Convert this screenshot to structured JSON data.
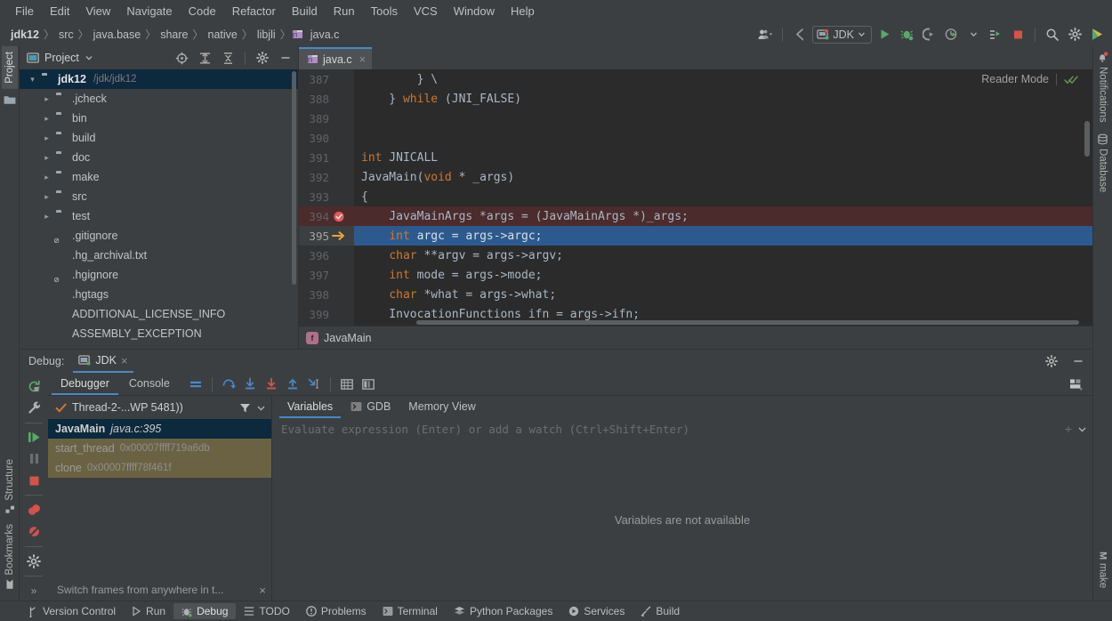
{
  "menubar": {
    "items": [
      "File",
      "Edit",
      "View",
      "Navigate",
      "Code",
      "Refactor",
      "Build",
      "Run",
      "Tools",
      "VCS",
      "Window",
      "Help"
    ]
  },
  "navbar": {
    "breadcrumbs": [
      "jdk12",
      "src",
      "java.base",
      "share",
      "native",
      "libjli",
      "java.c"
    ],
    "separator": "〉",
    "run_config": "JDK",
    "toolbar_icons": [
      "user-avatar-icon",
      "back-arrow-icon",
      "run-config-selector",
      "run-icon",
      "debug-icon",
      "run-with-coverage-icon",
      "profiler-icon",
      "attach-process-icon",
      "stop-icon",
      "search-everywhere-icon",
      "settings-gear-icon",
      "code-with-me-icon"
    ]
  },
  "left_strip": {
    "tabs": [
      "Project",
      "Structure",
      "Bookmarks"
    ],
    "active": "Project"
  },
  "right_strip": {
    "tabs": [
      "Notifications",
      "Database",
      "make"
    ]
  },
  "project_panel": {
    "title": "Project",
    "toolbar": [
      "select-opened-file-icon",
      "expand-all-icon",
      "collapse-all-icon",
      "settings-gear-icon",
      "hide-icon"
    ],
    "tree": [
      {
        "label": "jdk12",
        "path": "/jdk/jdk12",
        "type": "folder",
        "expanded": true,
        "selected": true,
        "indent": 0
      },
      {
        "label": ".jcheck",
        "type": "folder",
        "expanded": false,
        "indent": 1
      },
      {
        "label": "bin",
        "type": "folder",
        "expanded": false,
        "indent": 1
      },
      {
        "label": "build",
        "type": "folder",
        "expanded": false,
        "indent": 1
      },
      {
        "label": "doc",
        "type": "folder",
        "expanded": false,
        "indent": 1
      },
      {
        "label": "make",
        "type": "folder",
        "expanded": false,
        "indent": 1
      },
      {
        "label": "src",
        "type": "folder",
        "expanded": false,
        "indent": 1
      },
      {
        "label": "test",
        "type": "folder",
        "expanded": false,
        "indent": 1
      },
      {
        "label": ".gitignore",
        "type": "file-ignore",
        "indent": 1
      },
      {
        "label": ".hg_archival.txt",
        "type": "file",
        "indent": 1
      },
      {
        "label": ".hgignore",
        "type": "file-ignore",
        "indent": 1
      },
      {
        "label": ".hgtags",
        "type": "file",
        "indent": 1
      },
      {
        "label": "ADDITIONAL_LICENSE_INFO",
        "type": "file",
        "indent": 1
      },
      {
        "label": "ASSEMBLY_EXCEPTION",
        "type": "file",
        "indent": 1
      }
    ]
  },
  "editor": {
    "tab": {
      "label": "java.c",
      "icon": "c-file-icon",
      "close": "×"
    },
    "reader_mode": "Reader Mode",
    "breadcrumb": "JavaMain",
    "breadcrumb_icon": "f",
    "lines": [
      {
        "no": "387",
        "marker": "",
        "text": "        } \\",
        "state": ""
      },
      {
        "no": "388",
        "marker": "",
        "text": "    } while (JNI_FALSE)",
        "state": "",
        "kw": "while"
      },
      {
        "no": "389",
        "marker": "",
        "text": "",
        "state": ""
      },
      {
        "no": "390",
        "marker": "",
        "text": "",
        "state": ""
      },
      {
        "no": "391",
        "marker": "",
        "text": "int JNICALL",
        "state": "",
        "kw": "int"
      },
      {
        "no": "392",
        "marker": "fold",
        "text": "JavaMain(void * _args)",
        "state": "",
        "kw": "void"
      },
      {
        "no": "393",
        "marker": "",
        "text": "{",
        "state": ""
      },
      {
        "no": "394",
        "marker": "breakpoint",
        "text": "    JavaMainArgs *args = (JavaMainArgs *)_args;",
        "state": "bp"
      },
      {
        "no": "395",
        "marker": "execution-point",
        "text": "    int argc = args->argc;",
        "state": "cur",
        "kw": "int"
      },
      {
        "no": "396",
        "marker": "",
        "text": "    char **argv = args->argv;",
        "state": "",
        "kw": "char"
      },
      {
        "no": "397",
        "marker": "",
        "text": "    int mode = args->mode;",
        "state": "",
        "kw": "int"
      },
      {
        "no": "398",
        "marker": "",
        "text": "    char *what = args->what;",
        "state": "",
        "kw": "char"
      },
      {
        "no": "399",
        "marker": "",
        "text": "    InvocationFunctions ifn = args->ifn;",
        "state": ""
      }
    ]
  },
  "debug_window": {
    "label": "Debug:",
    "session_tab": "JDK",
    "session_close": "×",
    "header_buttons": [
      "settings-gear-icon",
      "hide-icon"
    ],
    "side_tools": [
      "rerun-icon",
      "wrench-icon",
      "resume-program-icon",
      "pause-program-icon",
      "stop-icon",
      "view-breakpoints-icon",
      "mute-breakpoints-icon",
      "settings-gear-icon",
      "more-icon"
    ],
    "more_label": "»",
    "tabs": [
      {
        "label": "Debugger",
        "active": true
      },
      {
        "label": "Console",
        "active": false
      }
    ],
    "step_tools": [
      "show-execution-point-icon",
      "step-over-icon",
      "step-into-icon",
      "force-step-into-icon",
      "step-out-icon",
      "run-to-cursor-icon",
      "evaluate-expression-icon",
      "layout-settings-icon"
    ],
    "frames": {
      "thread": "Thread-2-...WP 5481))",
      "thread_status_icon": "check-icon",
      "filter_icon": "filter-icon",
      "dropdown_icon": "chevron-down-icon",
      "items": [
        {
          "name": "JavaMain",
          "location": "java.c:395",
          "selected": true,
          "dim": false
        },
        {
          "name": "start_thread",
          "location": "0x00007ffff719a6db",
          "selected": false,
          "dim": true
        },
        {
          "name": "clone",
          "location": "0x00007ffff78f461f",
          "selected": false,
          "dim": true
        }
      ],
      "hint": "Switch frames from anywhere in t...",
      "hint_close": "×"
    },
    "variables": {
      "tabs": [
        {
          "label": "Variables",
          "active": true,
          "icon": ""
        },
        {
          "label": "GDB",
          "active": false,
          "icon": "console-icon"
        },
        {
          "label": "Memory View",
          "active": false,
          "icon": ""
        }
      ],
      "evaluate_placeholder": "Evaluate expression (Enter) or add a watch (Ctrl+Shift+Enter)",
      "empty_message": "Variables are not available",
      "add_watch_icon": "plus-icon",
      "expand_icon": "chevron-down-icon"
    }
  },
  "status_bar": {
    "items": [
      {
        "label": "Version Control",
        "icon": "branch-icon",
        "active": false
      },
      {
        "label": "Run",
        "icon": "run-icon",
        "active": false
      },
      {
        "label": "Debug",
        "icon": "debug-icon",
        "active": true
      },
      {
        "label": "TODO",
        "icon": "todo-list-icon",
        "active": false
      },
      {
        "label": "Problems",
        "icon": "problems-icon",
        "active": false
      },
      {
        "label": "Terminal",
        "icon": "terminal-icon",
        "active": false
      },
      {
        "label": "Python Packages",
        "icon": "python-packages-icon",
        "active": false
      },
      {
        "label": "Services",
        "icon": "services-icon",
        "active": false
      },
      {
        "label": "Build",
        "icon": "build-hammer-icon",
        "active": false
      }
    ]
  },
  "colors": {
    "background": "#3c3f41",
    "editor_bg": "#2b2b2b",
    "accent_blue": "#4a88c7",
    "selection_blue": "#2d5a8e",
    "tree_selection": "#0d293e",
    "breakpoint_red": "#4b2b2b",
    "frame_dim": "#6b6243",
    "keyword_orange": "#cc7832",
    "text": "#a9b7c6"
  }
}
